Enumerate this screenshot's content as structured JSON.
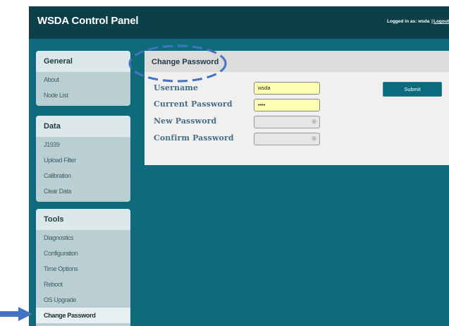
{
  "app": {
    "title": "WSDA Control Panel",
    "login_prefix": "Logged in as:",
    "username": "wsda",
    "separator": "|",
    "logout_label": "Logout"
  },
  "sidebar": {
    "general": {
      "title": "General",
      "items": [
        "About",
        "Node List"
      ]
    },
    "data": {
      "title": "Data",
      "items": [
        "J1939",
        "Upload Filter",
        "Calibration",
        "Clear Data"
      ]
    },
    "tools": {
      "title": "Tools",
      "items": [
        "Diagnostics",
        "Configuration",
        "Time Options",
        "Reboot",
        "OS Upgrade",
        "Change Password"
      ],
      "active": "Change Password"
    }
  },
  "main": {
    "title": "Change Password",
    "fields": {
      "username": {
        "label": "Username",
        "value": "wsda"
      },
      "current_password": {
        "label": "Current Password",
        "value": "••••"
      },
      "new_password": {
        "label": "New Password",
        "value": ""
      },
      "confirm_password": {
        "label": "Confirm Password",
        "value": ""
      }
    },
    "submit_label": "Submit"
  },
  "annotations": {
    "callout_color": "#4472c4",
    "arrow_color": "#4472c4",
    "accent_color": "#0f6a7c"
  },
  "icons": {
    "field_icon": "password-reveal-icon",
    "arrow": "pointer-arrow-icon"
  }
}
